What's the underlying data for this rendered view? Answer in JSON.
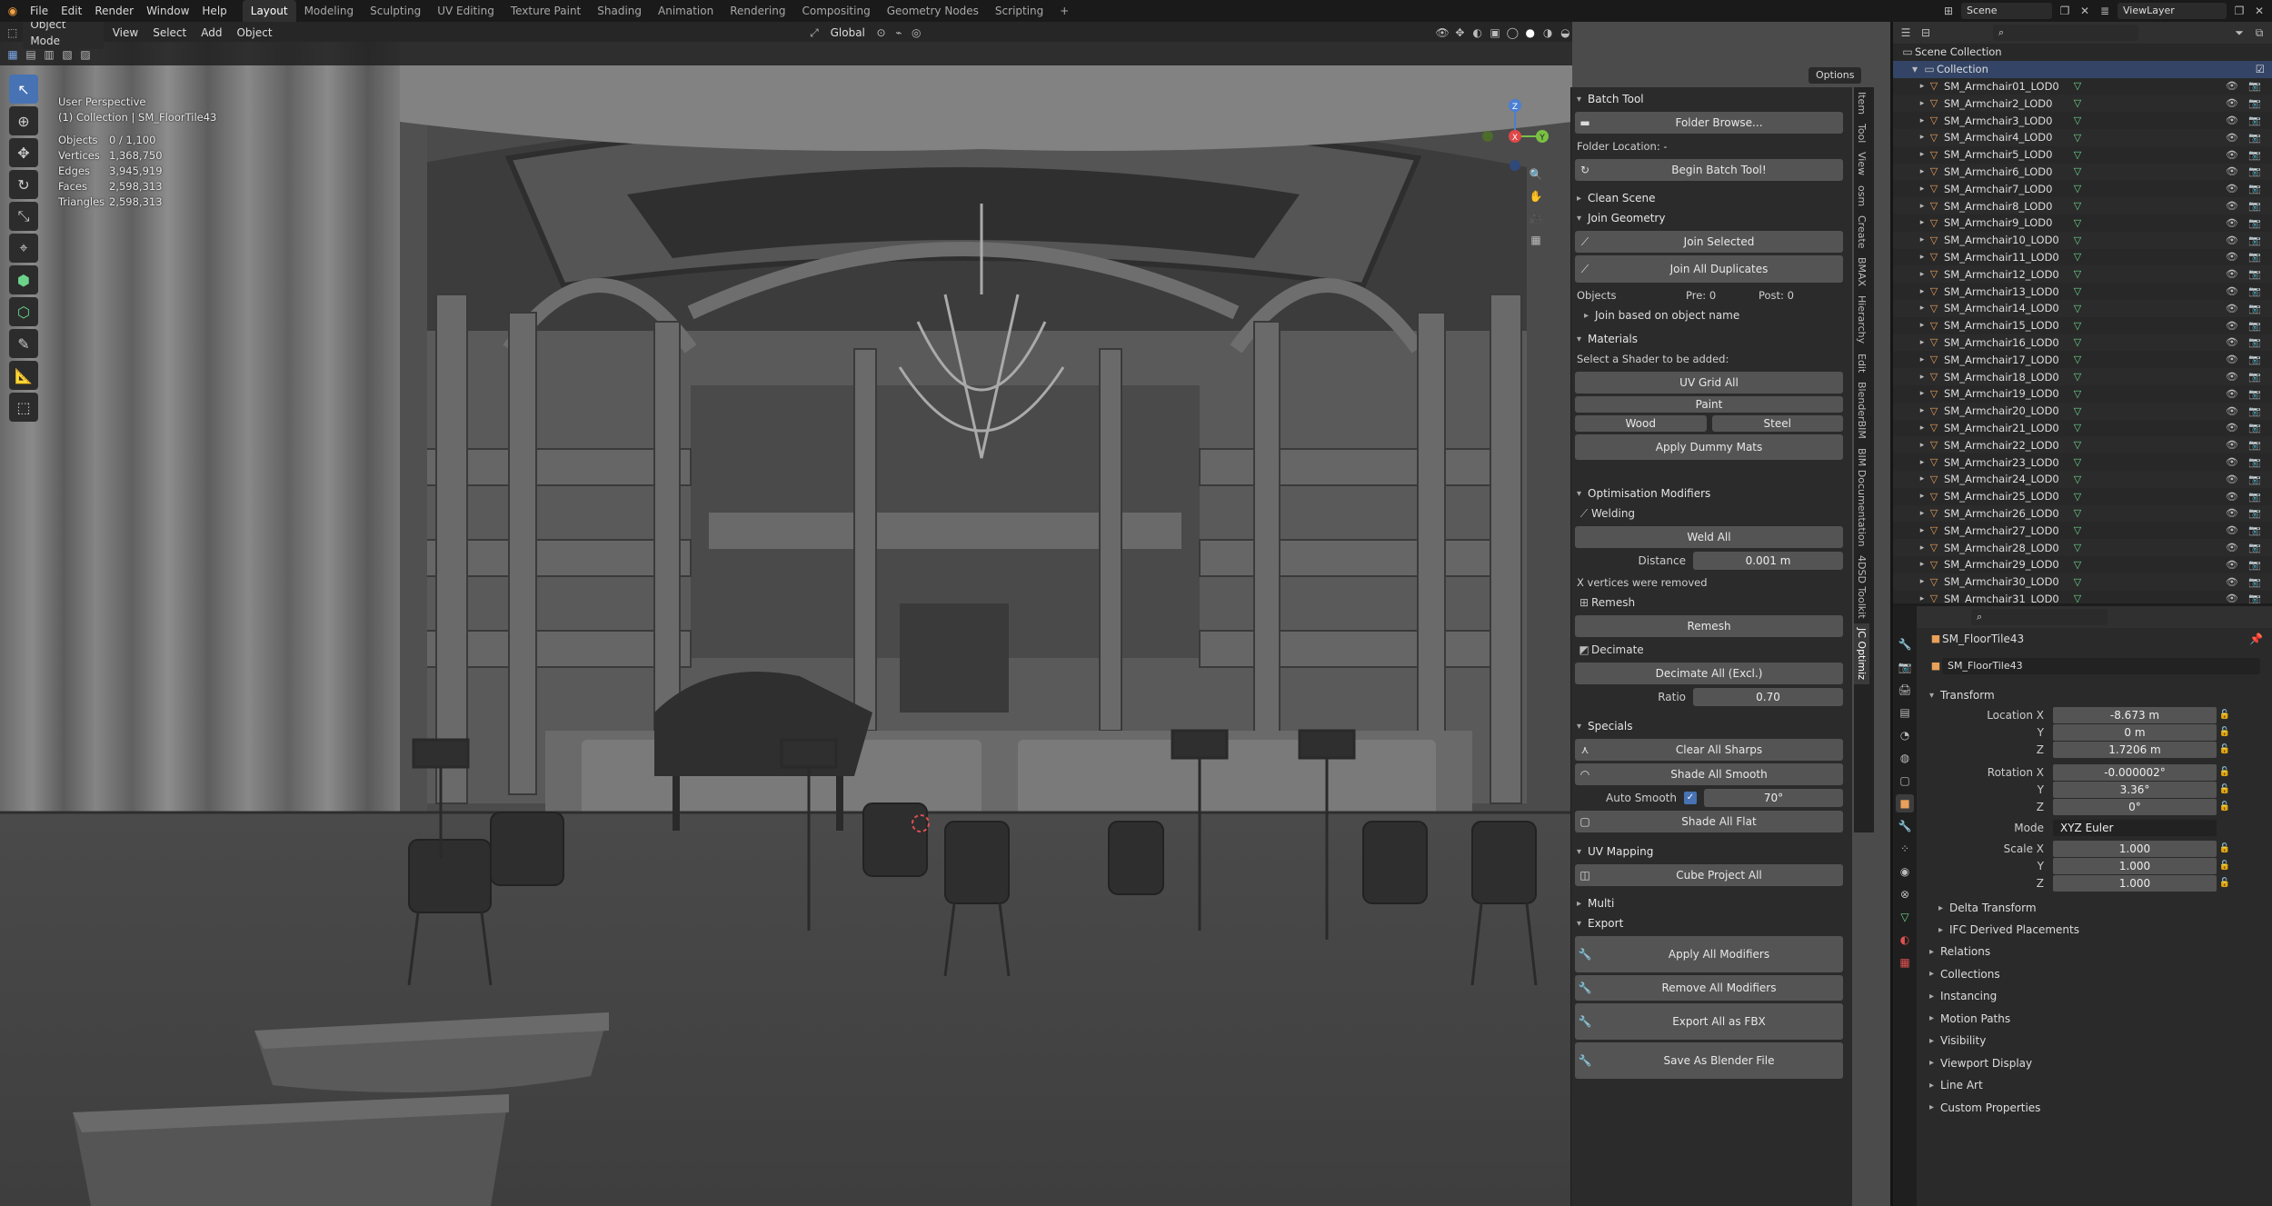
{
  "topbar": {
    "menus": [
      "File",
      "Edit",
      "Render",
      "Window",
      "Help"
    ],
    "workspaces": [
      "Layout",
      "Modeling",
      "Sculpting",
      "UV Editing",
      "Texture Paint",
      "Shading",
      "Animation",
      "Rendering",
      "Compositing",
      "Geometry Nodes",
      "Scripting"
    ],
    "active_workspace": "Layout",
    "add_tab": "+",
    "scene": "Scene",
    "view_layer": "ViewLayer"
  },
  "viewport": {
    "mode": "Object Mode",
    "menus": [
      "View",
      "Select",
      "Add",
      "Object"
    ],
    "orientation": "Global",
    "options": "Options",
    "view_name": "User Perspective",
    "collection_line": "(1) Collection | SM_FloorTile43",
    "stats": [
      {
        "label": "Objects",
        "value": "0 / 1,100"
      },
      {
        "label": "Vertices",
        "value": "1,368,750"
      },
      {
        "label": "Edges",
        "value": "3,945,919"
      },
      {
        "label": "Faces",
        "value": "2,598,313"
      },
      {
        "label": "Triangles",
        "value": "2,598,313"
      }
    ],
    "gizmo": {
      "x": "X",
      "y": "Y",
      "z": "Z"
    }
  },
  "npanel": {
    "batch_tool": "Batch Tool",
    "folder_browse": "Folder Browse...",
    "folder_location": "Folder Location: -",
    "begin_batch": "Begin Batch Tool!",
    "clean_scene": "Clean Scene",
    "join_geometry": "Join Geometry",
    "join_selected": "Join Selected",
    "join_all_duplicates": "Join All Duplicates",
    "objects_label": "Objects",
    "pre": "Pre: 0",
    "post": "Post: 0",
    "join_by_name": "Join based on object name",
    "materials": "Materials",
    "select_shader": "Select a Shader to be added:",
    "uv_grid_all": "UV Grid All",
    "paint": "Paint",
    "wood": "Wood",
    "steel": "Steel",
    "apply_dummy": "Apply Dummy Mats",
    "optim_mods": "Optimisation Modifiers",
    "welding": "Welding",
    "weld_all": "Weld All",
    "distance_label": "Distance",
    "distance_value": "0.001 m",
    "x_removed": "X vertices were removed",
    "remesh_lbl": "Remesh",
    "remesh_btn": "Remesh",
    "decimate_lbl": "Decimate",
    "decimate_all": "Decimate All (Excl.)",
    "ratio_label": "Ratio",
    "ratio_value": "0.70",
    "specials": "Specials",
    "clear_sharps": "Clear All Sharps",
    "shade_smooth": "Shade All Smooth",
    "auto_smooth": "Auto Smooth",
    "auto_smooth_angle": "70°",
    "shade_flat": "Shade All Flat",
    "uv_mapping": "UV Mapping",
    "cube_project": "Cube Project All",
    "multi": "Multi",
    "export": "Export",
    "apply_modifiers": "Apply All Modifiers",
    "remove_modifiers": "Remove All Modifiers",
    "export_fbx": "Export All as FBX",
    "save_blend": "Save As Blender File"
  },
  "ntabs": [
    "Item",
    "Tool",
    "View",
    "osm",
    "Create",
    "BMAX",
    "Hierarchy",
    "Edit",
    "BlenderBIM",
    "BIM Documentation",
    "4DSD Toolkit",
    "JC Optimiz"
  ],
  "outliner": {
    "scene_collection": "Scene Collection",
    "collection": "Collection",
    "items": [
      "SM_Armchair01_LOD0",
      "SM_Armchair2_LOD0",
      "SM_Armchair3_LOD0",
      "SM_Armchair4_LOD0",
      "SM_Armchair5_LOD0",
      "SM_Armchair6_LOD0",
      "SM_Armchair7_LOD0",
      "SM_Armchair8_LOD0",
      "SM_Armchair9_LOD0",
      "SM_Armchair10_LOD0",
      "SM_Armchair11_LOD0",
      "SM_Armchair12_LOD0",
      "SM_Armchair13_LOD0",
      "SM_Armchair14_LOD0",
      "SM_Armchair15_LOD0",
      "SM_Armchair16_LOD0",
      "SM_Armchair17_LOD0",
      "SM_Armchair18_LOD0",
      "SM_Armchair19_LOD0",
      "SM_Armchair20_LOD0",
      "SM_Armchair21_LOD0",
      "SM_Armchair22_LOD0",
      "SM_Armchair23_LOD0",
      "SM_Armchair24_LOD0",
      "SM_Armchair25_LOD0",
      "SM_Armchair26_LOD0",
      "SM_Armchair27_LOD0",
      "SM_Armchair28_LOD0",
      "SM_Armchair29_LOD0",
      "SM_Armchair30_LOD0",
      "SM_Armchair31_LOD0"
    ]
  },
  "properties": {
    "object_name": "SM_FloorTile43",
    "datablock": "SM_FloorTile43",
    "transform": "Transform",
    "location_label": "Location X",
    "location": [
      "-8.673 m",
      "0 m",
      "1.7206 m"
    ],
    "rotation_label": "Rotation X",
    "rotation": [
      "-0.000002°",
      "3.36°",
      "0°"
    ],
    "mode_label": "Mode",
    "mode_value": "XYZ Euler",
    "scale_label": "Scale X",
    "scale": [
      "1.000",
      "1.000",
      "1.000"
    ],
    "axis_y": "Y",
    "axis_z": "Z",
    "delta_transform": "Delta Transform",
    "ifc_derived": "IFC Derived Placements",
    "sections": [
      "Relations",
      "Collections",
      "Instancing",
      "Motion Paths",
      "Visibility",
      "Viewport Display",
      "Line Art",
      "Custom Properties"
    ]
  },
  "colors": {
    "accent": "#4772b3",
    "object": "#e8a05a",
    "mesh": "#6cd38a"
  }
}
